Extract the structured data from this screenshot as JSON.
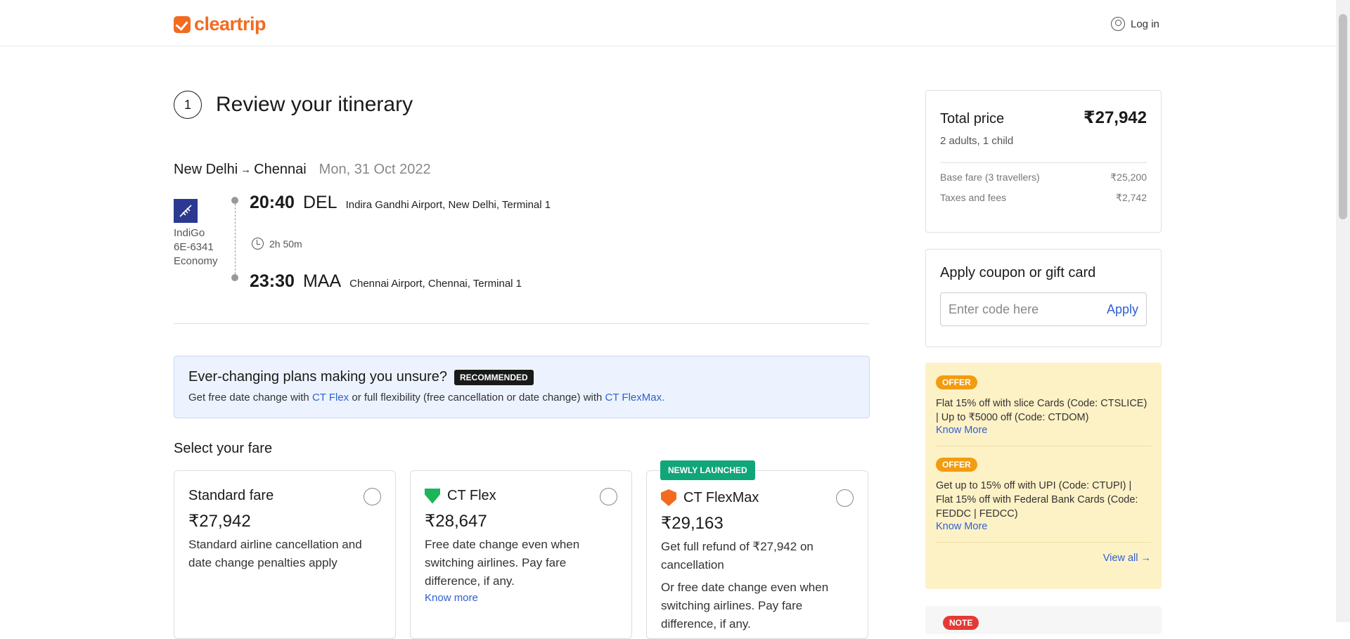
{
  "header": {
    "logo_text": "cleartrip",
    "login_label": "Log in"
  },
  "step": {
    "number": "1",
    "title": "Review your itinerary"
  },
  "itinerary": {
    "from": "New Delhi",
    "arrow": "→",
    "to": "Chennai",
    "date": "Mon, 31 Oct 2022",
    "airline": "IndiGo",
    "flight_no": "6E-6341",
    "cabin": "Economy",
    "depart": {
      "time": "20:40",
      "code": "DEL",
      "airport": "Indira Gandhi Airport, New Delhi, Terminal 1"
    },
    "duration": "2h 50m",
    "arrive": {
      "time": "23:30",
      "code": "MAA",
      "airport": "Chennai Airport, Chennai, Terminal 1"
    }
  },
  "banner": {
    "title": "Ever-changing plans making you unsure?",
    "badge": "RECOMMENDED",
    "text_1": "Get free date change with ",
    "link_1": "CT Flex",
    "text_2": " or full flexibility (free cancellation or date change) with ",
    "link_2": "CT FlexMax."
  },
  "fares": {
    "heading": "Select your fare",
    "standard": {
      "name": "Standard fare",
      "price": "₹27,942",
      "desc": "Standard airline cancellation and date change penalties apply"
    },
    "flex": {
      "name": "CT Flex",
      "price": "₹28,647",
      "desc": "Free date change even when switching airlines. Pay fare difference, if any.",
      "know_more": "Know more"
    },
    "flexmax": {
      "badge": "NEWLY LAUNCHED",
      "name": "CT FlexMax",
      "price": "₹29,163",
      "desc": "Get full refund of ₹27,942 on cancellation",
      "desc2": "Or free date change even when switching airlines. Pay fare difference, if any."
    }
  },
  "summary": {
    "label": "Total price",
    "total": "₹27,942",
    "travellers": "2 adults, 1 child",
    "base_label": "Base fare (3 travellers)",
    "base_value": "₹25,200",
    "taxes_label": "Taxes and fees",
    "taxes_value": "₹2,742"
  },
  "coupon": {
    "title": "Apply coupon or gift card",
    "placeholder": "Enter code here",
    "apply": "Apply"
  },
  "offers": {
    "items": [
      {
        "badge": "OFFER",
        "text": "Flat 15% off with slice Cards (Code: CTSLICE) | Up to ₹5000 off (Code: CTDOM)",
        "link": "Know More"
      },
      {
        "badge": "OFFER",
        "text": "Get up to 15% off with UPI (Code: CTUPI) | Flat 15% off with Federal Bank Cards (Code: FEDDC | FEDCC)",
        "link": "Know More"
      }
    ],
    "view_all": "View all →"
  },
  "note": {
    "badge": "NOTE"
  },
  "colors": {
    "brand": "#f26b21",
    "link": "#2f5fd3",
    "offer_bg": "#fdf1c6",
    "new_badge": "#11a67a"
  }
}
